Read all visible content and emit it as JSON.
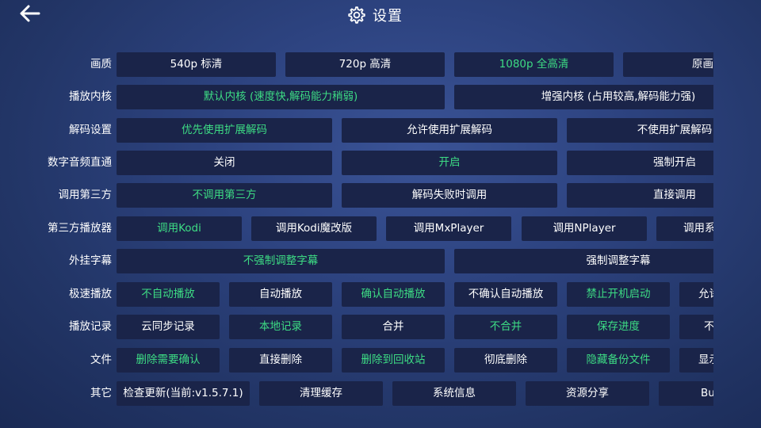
{
  "header": {
    "title": "设置",
    "back_icon": "arrow-left-icon",
    "title_icon": "gear-icon"
  },
  "colors": {
    "selected": "#3ddc84",
    "button_bg": "#1a2449",
    "text": "#ffffff"
  },
  "rows": [
    {
      "key": "quality",
      "label": "画质",
      "options": [
        {
          "label": "540p 标清",
          "selected": false
        },
        {
          "label": "720p 高清",
          "selected": false
        },
        {
          "label": "1080p 全高清",
          "selected": true
        },
        {
          "label": "原画",
          "selected": false
        }
      ]
    },
    {
      "key": "player-core",
      "label": "播放内核",
      "options": [
        {
          "label": "默认内核 (速度快,解码能力稍弱)",
          "selected": true
        },
        {
          "label": "增强内核 (占用较高,解码能力强)",
          "selected": false
        }
      ]
    },
    {
      "key": "decode",
      "label": "解码设置",
      "options": [
        {
          "label": "优先使用扩展解码",
          "selected": true
        },
        {
          "label": "允许使用扩展解码",
          "selected": false
        },
        {
          "label": "不使用扩展解码",
          "selected": false
        }
      ]
    },
    {
      "key": "audio-passthrough",
      "label": "数字音频直通",
      "options": [
        {
          "label": "关闭",
          "selected": false
        },
        {
          "label": "开启",
          "selected": true
        },
        {
          "label": "强制开启",
          "selected": false
        }
      ]
    },
    {
      "key": "third-party-call",
      "label": "调用第三方",
      "options": [
        {
          "label": "不调用第三方",
          "selected": true
        },
        {
          "label": "解码失败时调用",
          "selected": false
        },
        {
          "label": "直接调用",
          "selected": false
        }
      ]
    },
    {
      "key": "third-party-player",
      "label": "第三方播放器",
      "options": [
        {
          "label": "调用Kodi",
          "selected": true
        },
        {
          "label": "调用Kodi魔改版",
          "selected": false
        },
        {
          "label": "调用MxPlayer",
          "selected": false
        },
        {
          "label": "调用NPlayer",
          "selected": false
        },
        {
          "label": "调用系",
          "selected": false
        }
      ]
    },
    {
      "key": "external-subtitle",
      "label": "外挂字幕",
      "options": [
        {
          "label": "不强制调整字幕",
          "selected": true
        },
        {
          "label": "强制调整字幕",
          "selected": false
        }
      ]
    },
    {
      "key": "fast-play",
      "label": "极速播放",
      "options": [
        {
          "label": "不自动播放",
          "selected": true
        },
        {
          "label": "自动播放",
          "selected": false
        },
        {
          "label": "确认自动播放",
          "selected": true
        },
        {
          "label": "不确认自动播放",
          "selected": false
        },
        {
          "label": "禁止开机启动",
          "selected": true
        },
        {
          "label": "允许",
          "selected": false
        }
      ]
    },
    {
      "key": "play-history",
      "label": "播放记录",
      "options": [
        {
          "label": "云同步记录",
          "selected": false
        },
        {
          "label": "本地记录",
          "selected": true
        },
        {
          "label": "合并",
          "selected": false
        },
        {
          "label": "不合并",
          "selected": true
        },
        {
          "label": "保存进度",
          "selected": true
        },
        {
          "label": "不",
          "selected": false
        }
      ]
    },
    {
      "key": "file",
      "label": "文件",
      "options": [
        {
          "label": "删除需要确认",
          "selected": true
        },
        {
          "label": "直接删除",
          "selected": false
        },
        {
          "label": "删除到回收站",
          "selected": true
        },
        {
          "label": "彻底删除",
          "selected": false
        },
        {
          "label": "隐藏备份文件",
          "selected": true
        },
        {
          "label": "显示",
          "selected": false
        }
      ]
    },
    {
      "key": "other",
      "label": "其它",
      "options": [
        {
          "label": "检查更新(当前:v1.5.7.1)",
          "selected": false
        },
        {
          "label": "清理缓存",
          "selected": false
        },
        {
          "label": "系统信息",
          "selected": false
        },
        {
          "label": "资源分享",
          "selected": false
        },
        {
          "label": "Bu",
          "selected": false
        }
      ]
    }
  ]
}
